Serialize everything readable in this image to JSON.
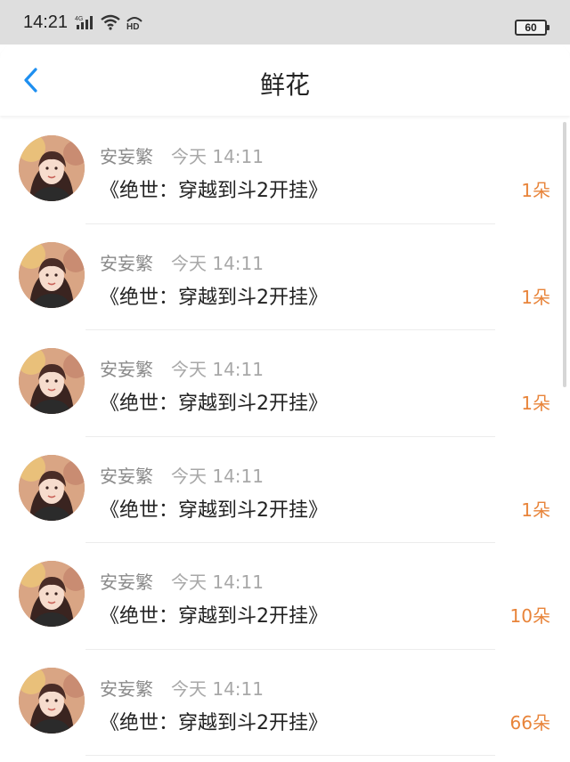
{
  "status_bar": {
    "time": "14:21",
    "network": "4G",
    "hd": "HD",
    "battery": "60"
  },
  "header": {
    "title": "鲜花",
    "back_icon": "chevron-left-icon"
  },
  "colors": {
    "accent": "#1e8ff0",
    "amount": "#e8843a"
  },
  "flowers": [
    {
      "user": "安妄繁",
      "time": "今天 14:11",
      "book": "《绝世：穿越到斗2开挂》",
      "amount": "1朵"
    },
    {
      "user": "安妄繁",
      "time": "今天 14:11",
      "book": "《绝世：穿越到斗2开挂》",
      "amount": "1朵"
    },
    {
      "user": "安妄繁",
      "time": "今天 14:11",
      "book": "《绝世：穿越到斗2开挂》",
      "amount": "1朵"
    },
    {
      "user": "安妄繁",
      "time": "今天 14:11",
      "book": "《绝世：穿越到斗2开挂》",
      "amount": "1朵"
    },
    {
      "user": "安妄繁",
      "time": "今天 14:11",
      "book": "《绝世：穿越到斗2开挂》",
      "amount": "10朵"
    },
    {
      "user": "安妄繁",
      "time": "今天 14:11",
      "book": "《绝世：穿越到斗2开挂》",
      "amount": "66朵"
    }
  ]
}
